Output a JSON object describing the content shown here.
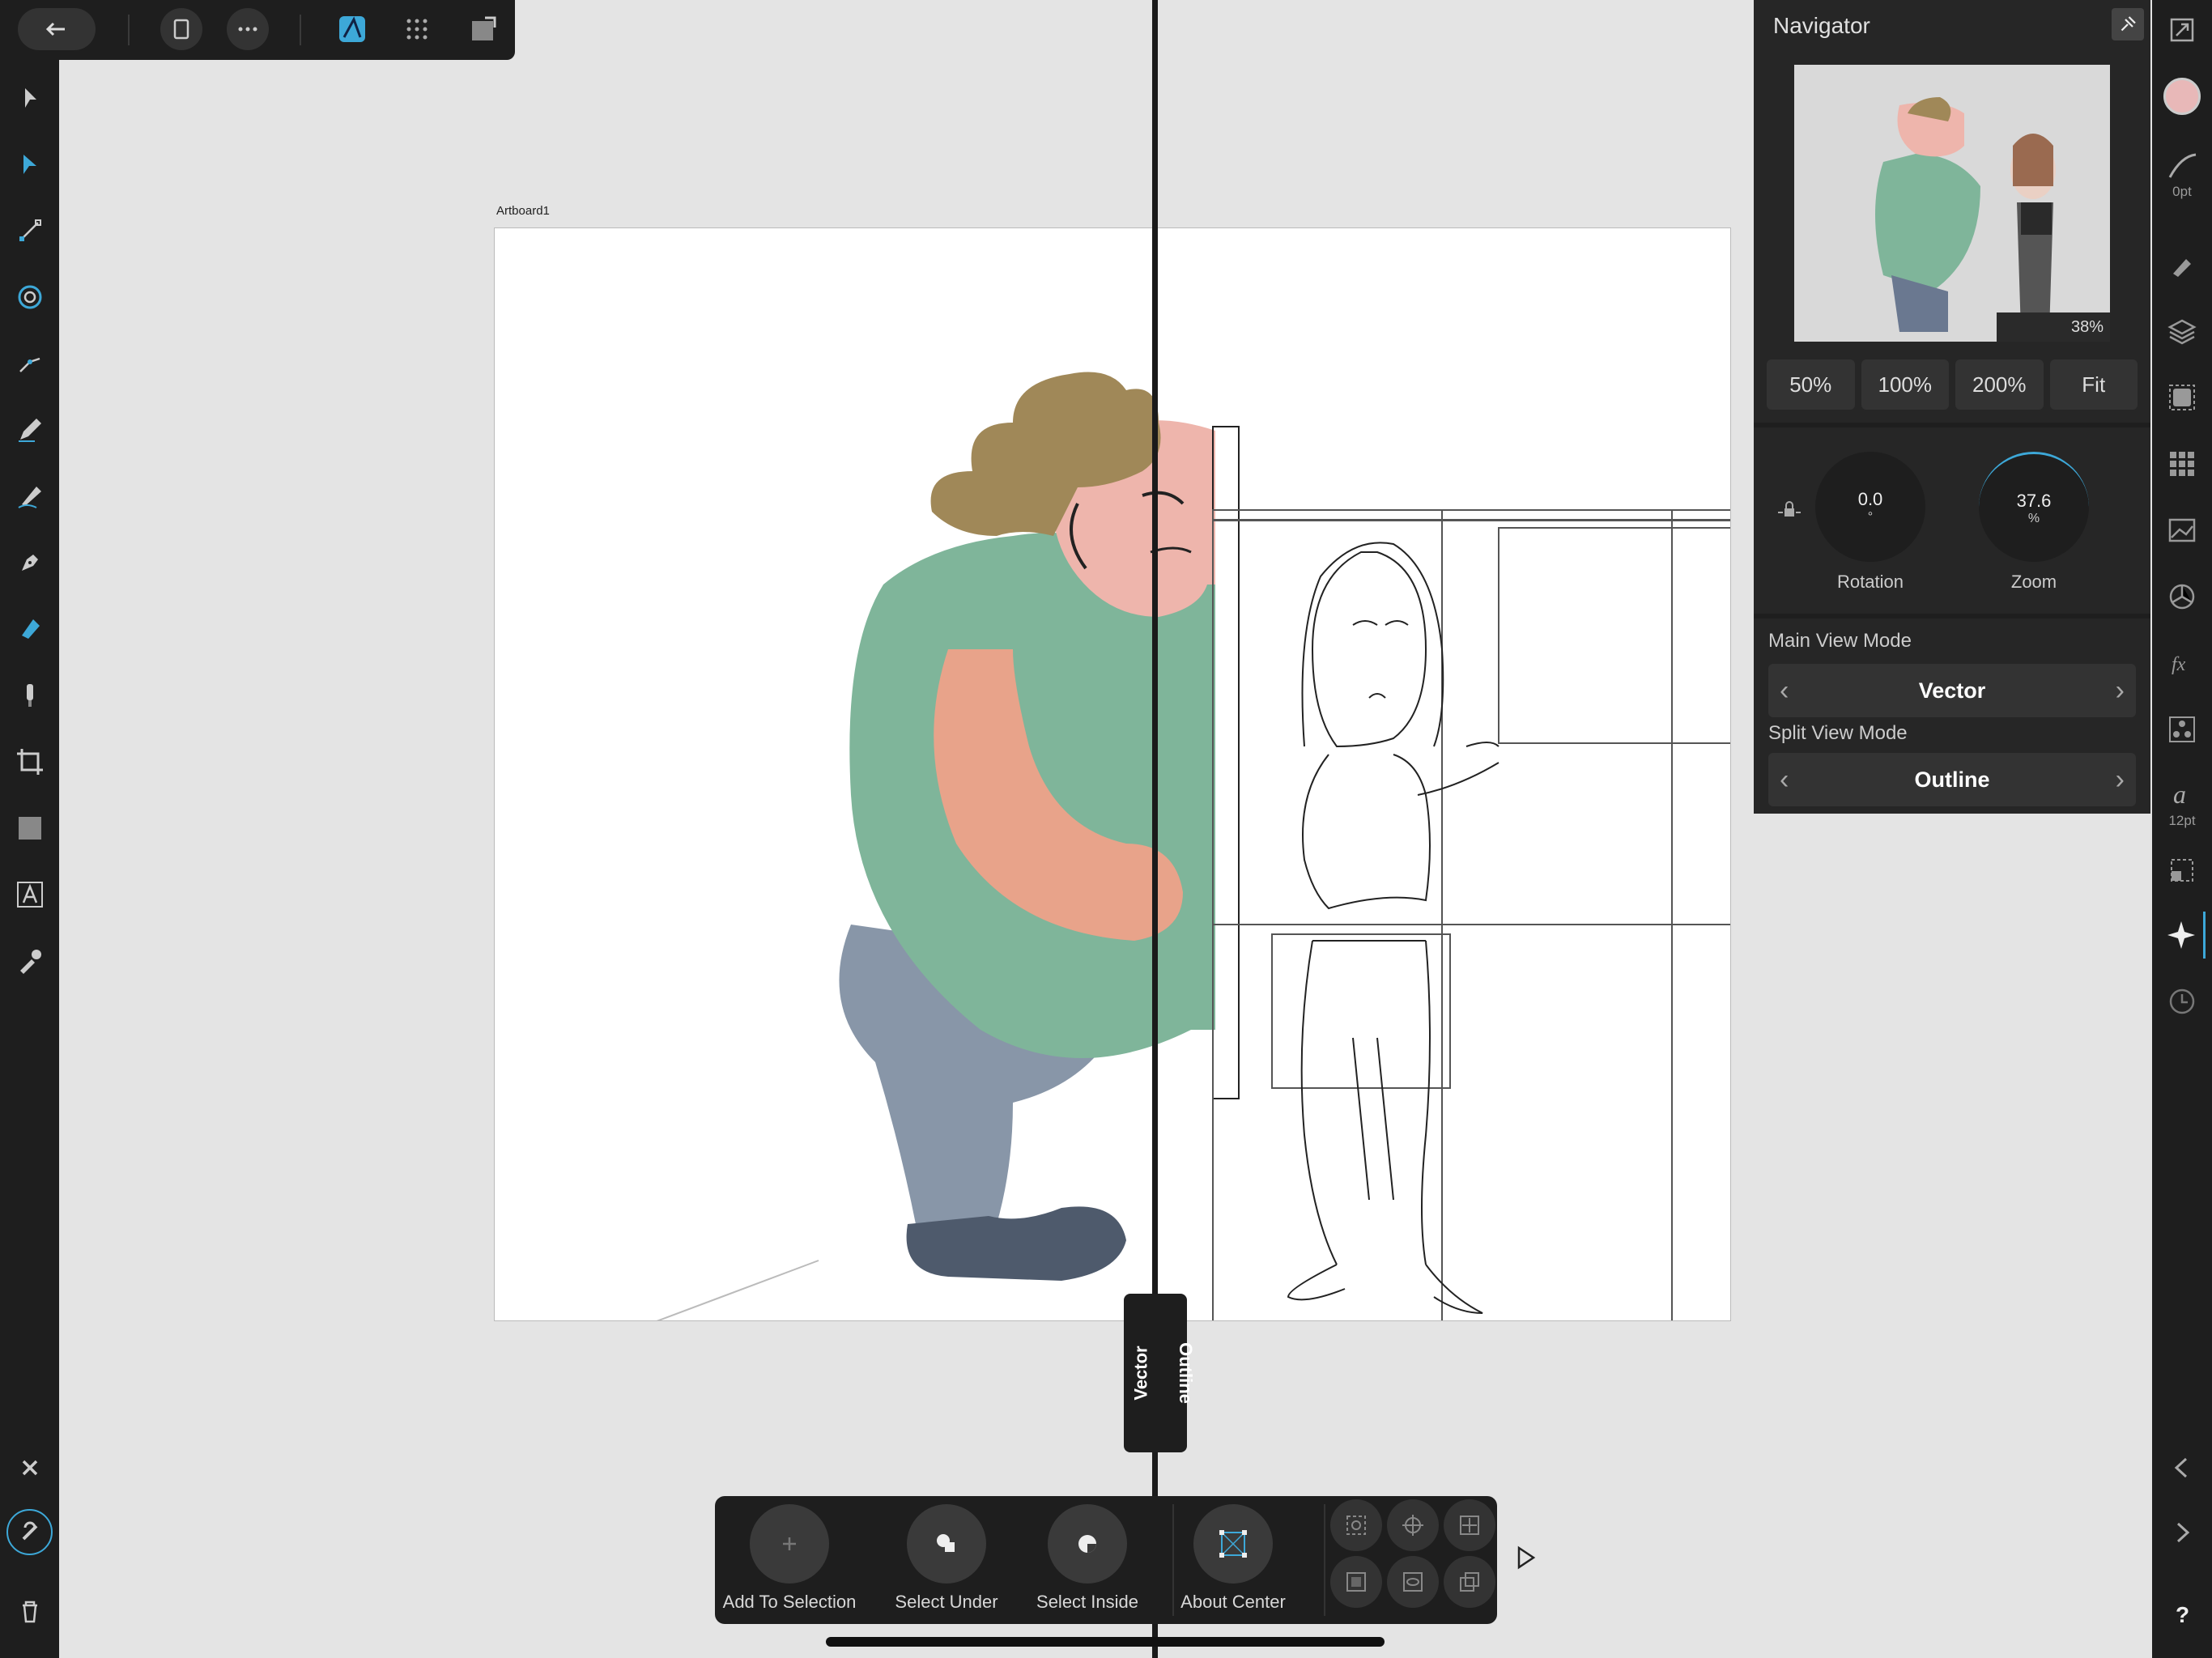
{
  "artboard": {
    "label": "Artboard1"
  },
  "split_view": {
    "left_label": "Vector",
    "right_label": "Outline"
  },
  "navigator": {
    "title": "Navigator",
    "preview_zoom": "38%",
    "zoom_presets": [
      "50%",
      "100%",
      "200%",
      "Fit"
    ],
    "rotation": {
      "value": "0.0",
      "unit": "°",
      "label": "Rotation"
    },
    "zoom": {
      "value": "37.6",
      "unit": "%",
      "label": "Zoom"
    },
    "main_view_mode": {
      "label": "Main View Mode",
      "value": "Vector"
    },
    "split_view_mode": {
      "label": "Split View Mode",
      "value": "Outline"
    }
  },
  "right_strip": {
    "stroke_width": "0pt",
    "font_size": "12pt"
  },
  "context_toolbar": {
    "add_to_selection": "Add To Selection",
    "select_under": "Select Under",
    "select_inside": "Select Inside",
    "about_center": "About Center"
  },
  "colors": {
    "fill_swatch": "#e8b8b8",
    "accent": "#3da8d8",
    "background": "#e4e4e4"
  }
}
